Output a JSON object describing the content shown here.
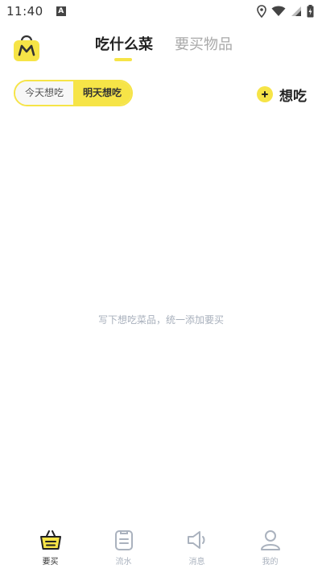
{
  "status_bar": {
    "time": "11:40",
    "notification_icon": "A"
  },
  "header": {
    "logo_letter": "M",
    "tabs": [
      {
        "label": "吃什么菜",
        "active": true
      },
      {
        "label": "要买物品",
        "active": false
      }
    ]
  },
  "toggle": {
    "today": "今天想吃",
    "tomorrow": "明天想吃",
    "selected": "tomorrow"
  },
  "want_button": {
    "label": "想吃",
    "icon": "plus-circle-icon"
  },
  "empty_state": {
    "text": "写下想吃菜品，统一添加要买"
  },
  "bottom_nav": {
    "items": [
      {
        "label": "要买",
        "icon": "basket-icon",
        "active": true
      },
      {
        "label": "流水",
        "icon": "list-icon",
        "active": false
      },
      {
        "label": "消息",
        "icon": "speaker-icon",
        "active": false
      },
      {
        "label": "我的",
        "icon": "person-icon",
        "active": false
      }
    ]
  },
  "colors": {
    "accent": "#f6e447",
    "inactive": "#aab2be"
  }
}
